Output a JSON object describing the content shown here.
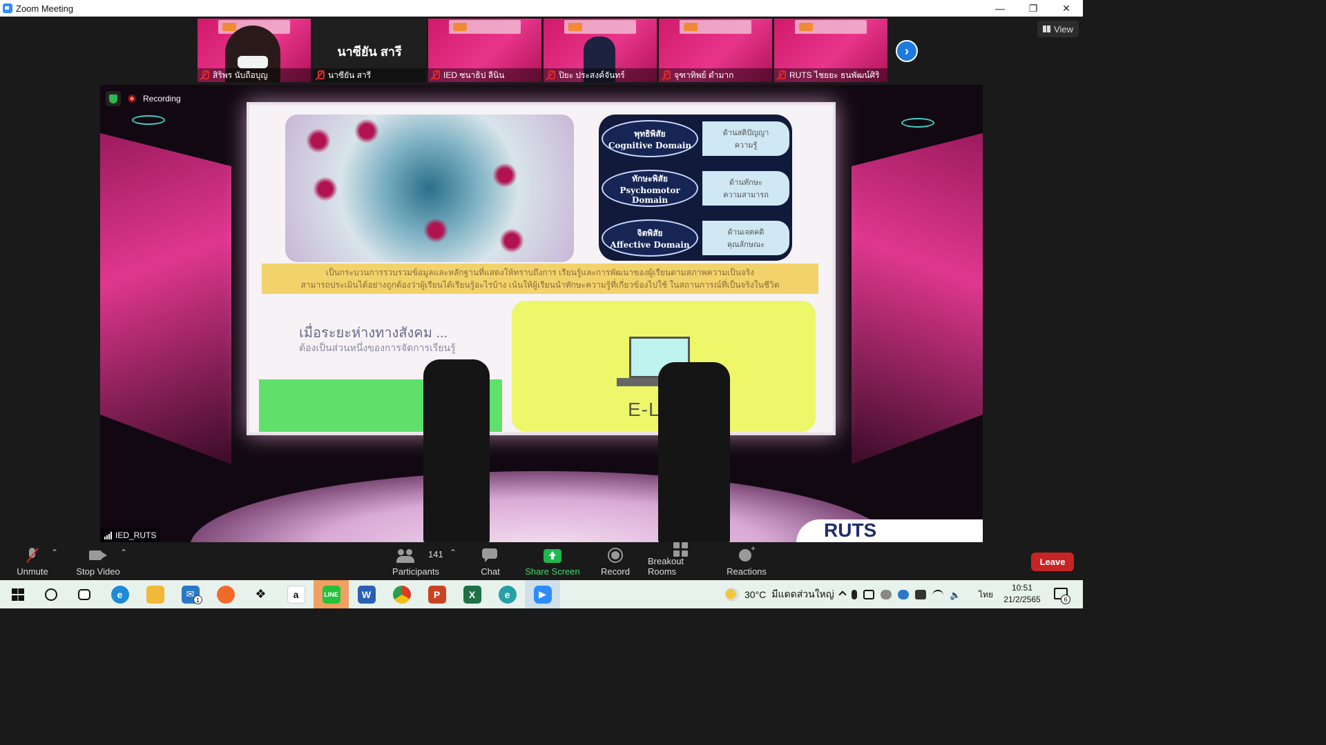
{
  "window": {
    "title": "Zoom Meeting"
  },
  "window_controls": {
    "minimize": "—",
    "maximize": "❐",
    "close": "✕"
  },
  "gallery": {
    "participants": [
      {
        "name": "สิริพร นับถือบุญ",
        "style": "face"
      },
      {
        "name": "นาซียัน สารี",
        "display_name": "นาซียัน สารี",
        "style": "dark"
      },
      {
        "name": "IED ซนาธิป ลีนิน",
        "style": "pink"
      },
      {
        "name": "ปิยะ ประสงค์จันทร์",
        "style": "figure"
      },
      {
        "name": "จุฑาทิพย์ ดำมาก",
        "style": "pink"
      },
      {
        "name": "RUTS ไชยยะ ธนพัฒน์ศิริ",
        "style": "pink"
      }
    ],
    "view_label": "View"
  },
  "video": {
    "recording_label": "Recording",
    "speaker_name": "IED_RUTS",
    "slide": {
      "domains": [
        {
          "thai": "พุทธิพิสัย",
          "english": "Cognitive Domain",
          "desc_1": "ด้านสติปัญญา",
          "desc_2": "ความรู้"
        },
        {
          "thai": "ทักษะพิสัย",
          "english": "Psychomotor Domain",
          "desc_1": "ด้านทักษะ",
          "desc_2": "ความสามารถ"
        },
        {
          "thai": "จิตพิสัย",
          "english": "Affective Domain",
          "desc_1": "ด้านเจตคติ",
          "desc_2": "คุณลักษณะ"
        }
      ],
      "caption_line_1": "เป็นกระบวนการรวบรวมข้อมูลและหลักฐานที่แสดงให้ทราบถึงการ เรียนรู้และการพัฒนาของผู้เรียนตามสภาพความเป็นจริง",
      "caption_line_2": "สามารถประเมินได้อย่างถูกต้องว่าผู้เรียนได้เรียนรู้อะไรบ้าง เน้นให้ผู้เรียนนำทักษะความรู้ที่เกี่ยวข้องไปใช้ ในสถานการณ์ที่เป็นจริงในชีวิต",
      "heading": "เมื่อระยะห่างทางสังคม ...",
      "subheading": "ต้องเป็นส่วนหนึ่งของการจัดการเรียนรู้",
      "elearning_label": "E-LEARNI"
    },
    "corner_logo": "RUTS"
  },
  "toolbar": {
    "unmute": "Unmute",
    "stop_video": "Stop Video",
    "participants": "Participants",
    "participant_count": "141",
    "chat": "Chat",
    "share_screen": "Share Screen",
    "record": "Record",
    "breakout_rooms": "Breakout Rooms",
    "reactions": "Reactions",
    "leave": "Leave"
  },
  "taskbar": {
    "apps": [
      "start",
      "search",
      "task-view",
      "edge",
      "file-explorer",
      "mail",
      "firefox",
      "dropbox",
      "amazon",
      "line",
      "word",
      "chrome",
      "powerpoint",
      "excel",
      "edge-beta",
      "zoom"
    ],
    "mail_badge": "1",
    "weather_temp": "30°C",
    "weather_text": "มีแดดส่วนใหญ่",
    "language": "ไทย",
    "time": "10:51",
    "date": "21/2/2565",
    "notification_count": "6"
  },
  "colors": {
    "accent_blue": "#2d8cff",
    "leave_red": "#c72525",
    "share_green": "#1fb84f",
    "stage_pink": "#e0378e"
  }
}
